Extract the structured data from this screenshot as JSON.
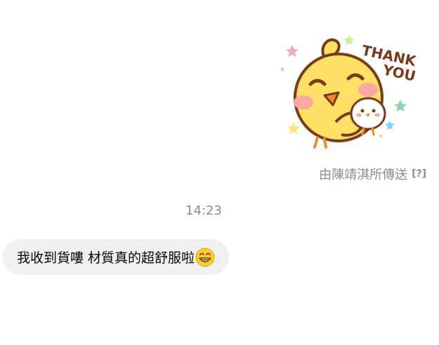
{
  "sticker": {
    "text_line1": "THANK",
    "text_line2": "YOU",
    "icon": "chick-thank-you-sticker"
  },
  "sent_by": {
    "label": "由陳靖淇所傳送",
    "help": "[?]"
  },
  "timestamp": "14:23",
  "message": {
    "text": "我收到貨嘍 材質真的超舒服啦",
    "emoji": "grinning-face-icon"
  },
  "colors": {
    "bubble_bg": "#f0f0f0",
    "meta_text": "#8a8d91",
    "message_text": "#050505",
    "chick_yellow": "#ffe066",
    "chick_outline": "#7a3b1a"
  }
}
